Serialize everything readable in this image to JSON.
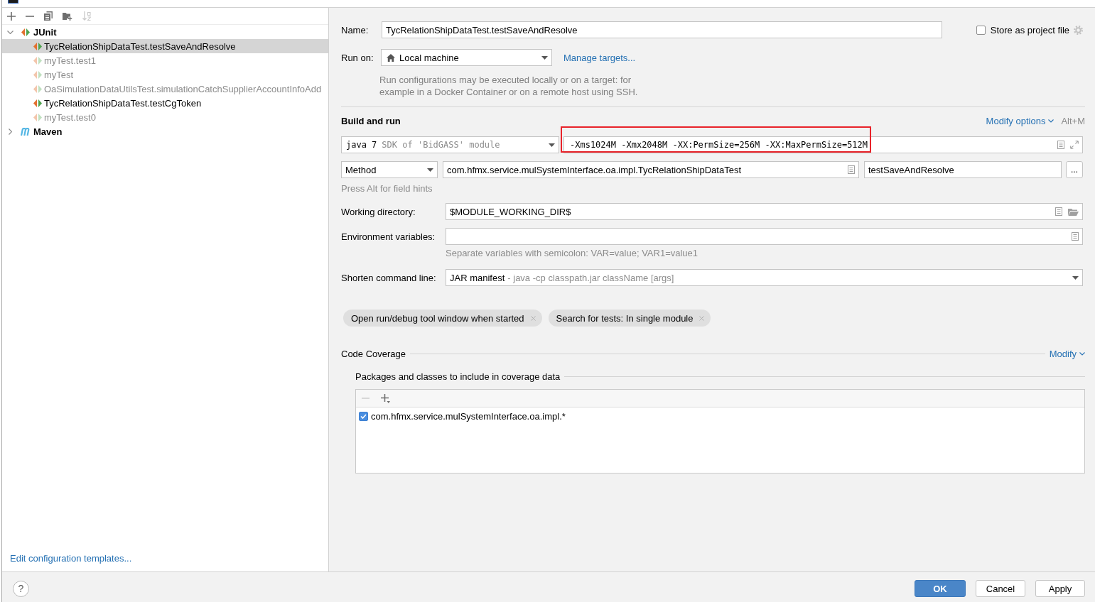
{
  "toolbar": [
    {
      "kind": "add",
      "disabled": false
    },
    {
      "kind": "remove",
      "disabled": false
    },
    {
      "kind": "copy",
      "disabled": false
    },
    {
      "kind": "new-folder",
      "disabled": false
    },
    {
      "kind": "sort",
      "disabled": true
    }
  ],
  "tree": [
    {
      "label": "JUnit",
      "kind": "junit",
      "expanded": true,
      "selected": false,
      "children": [
        {
          "label": "TycRelationShipDataTest.testSaveAndResolve",
          "kind": "junit",
          "selected": true,
          "dimmed": false
        },
        {
          "label": "myTest.test1",
          "kind": "junit",
          "selected": false,
          "dimmed": true
        },
        {
          "label": "myTest",
          "kind": "junit",
          "selected": false,
          "dimmed": true
        },
        {
          "label": "OaSimulationDataUtilsTest.simulationCatchSupplierAccountInfoAdd",
          "kind": "junit",
          "selected": false,
          "dimmed": true
        },
        {
          "label": "TycRelationShipDataTest.testCgToken",
          "kind": "junit",
          "selected": false,
          "dimmed": false
        },
        {
          "label": "myTest.test0",
          "kind": "junit",
          "selected": false,
          "dimmed": true
        }
      ]
    },
    {
      "label": "Maven",
      "kind": "maven",
      "expanded": false,
      "selected": false
    }
  ],
  "templates_link": "Edit configuration templates...",
  "form": {
    "name": {
      "label": "Name:",
      "value": "TycRelationShipDataTest.testSaveAndResolve"
    },
    "store_as_project_file": {
      "label": "Store as project file",
      "checked": false
    },
    "run_on": {
      "label": "Run on:",
      "value": "Local machine",
      "link": "Manage targets...",
      "description": "Run configurations may be executed locally or on a target: for example in a Docker Container or on a remote host using SSH."
    },
    "build_and_run": {
      "title": "Build and run",
      "modify_link": "Modify options",
      "shortcut": "Alt+M",
      "jre": {
        "value": "java 7",
        "hint": "SDK of 'BidGASS' module"
      },
      "vm_options": {
        "value": "-Xms1024M -Xmx2048M -XX:PermSize=256M -XX:MaxPermSize=512M",
        "highlighted": true
      },
      "test_kind": "Method",
      "test_class": "com.hfmx.service.mulSystemInterface.oa.impl.TycRelationShipDataTest",
      "method": "testSaveAndResolve",
      "more_button": "...",
      "hint": "Press Alt for field hints"
    },
    "working_directory": {
      "label": "Working directory:",
      "value": "$MODULE_WORKING_DIR$"
    },
    "environment_variables": {
      "label": "Environment variables:",
      "hint": "Separate variables with semicolon: VAR=value; VAR1=value1"
    },
    "shorten_command_line": {
      "label": "Shorten command line:",
      "value": "JAR manifest",
      "hint": "- java -cp classpath.jar className [args]"
    },
    "options": [
      {
        "label": "Open run/debug tool window when started"
      },
      {
        "label": "Search for tests: In single module"
      }
    ],
    "code_coverage": {
      "title": "Code Coverage",
      "modify_link": "Modify",
      "packages_title": "Packages and classes to include in coverage data",
      "toolbar": [
        {
          "kind": "remove",
          "disabled": true
        },
        {
          "kind": "add",
          "disabled": false
        }
      ],
      "patterns": [
        {
          "label": "com.hfmx.service.mulSystemInterface.oa.impl.*",
          "checked": true
        }
      ]
    }
  },
  "help_button": "?",
  "buttons": [
    {
      "label": "OK",
      "default": true
    },
    {
      "label": "Cancel",
      "default": false
    },
    {
      "label": "Apply",
      "default": false
    }
  ]
}
